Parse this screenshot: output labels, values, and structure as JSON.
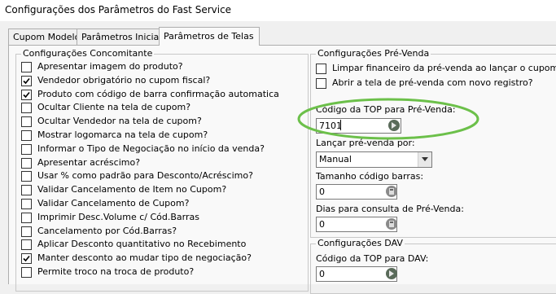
{
  "window": {
    "title": "Configurações dos Parâmetros do Fast Service"
  },
  "tabs": [
    {
      "label": "Cupom Modelo"
    },
    {
      "label": "Parâmetros Iniciais"
    },
    {
      "label": "Parâmetros de Telas"
    }
  ],
  "active_tab": "Parâmetros de Telas",
  "concomitante": {
    "legend": "Configurações Concomitante",
    "items": [
      {
        "label": "Apresentar imagem do produto?",
        "checked": false
      },
      {
        "label": "Vendedor obrigatório no cupom fiscal?",
        "checked": true
      },
      {
        "label": "Produto com código de barra confirmação automatica",
        "checked": true
      },
      {
        "label": "Ocultar Cliente na tela de cupom?",
        "checked": false
      },
      {
        "label": "Ocultar Vendedor na tela de cupom?",
        "checked": false
      },
      {
        "label": "Mostrar logomarca na tela de cupom?",
        "checked": false
      },
      {
        "label": "Informar o Tipo de Negociação no início da venda?",
        "checked": false
      },
      {
        "label": "Apresentar acréscimo?",
        "checked": false
      },
      {
        "label": "Usar % como padrão para Desconto/Acréscimo?",
        "checked": false
      },
      {
        "label": "Validar Cancelamento de Item no Cupom?",
        "checked": false
      },
      {
        "label": "Validar Cancelamento de Cupom?",
        "checked": false
      },
      {
        "label": "Imprimir Desc.Volume c/ Cód.Barras",
        "checked": false
      },
      {
        "label": "Cancelamento por Cód.Barras?",
        "checked": false
      },
      {
        "label": "Aplicar Desconto quantitativo no Recebimento",
        "checked": false
      },
      {
        "label": "Manter desconto ao mudar tipo de negociação?",
        "checked": true
      },
      {
        "label": "Permite troco na troca de produto?",
        "checked": false
      }
    ]
  },
  "prevenda": {
    "legend": "Configurações Pré-Venda",
    "checks": [
      {
        "label": "Limpar financeiro da pré-venda ao lançar o cupom?",
        "checked": false
      },
      {
        "label": "Abrir a tela de pré-venda com novo registro?",
        "checked": false
      }
    ],
    "top_label": "Código da TOP para Pré-Venda:",
    "top_value": "7101",
    "lancar_label": "Lançar pré-venda por:",
    "lancar_value": "Manual",
    "barras_label": "Tamanho código barras:",
    "barras_value": "0",
    "dias_label": "Dias para consulta de Pré-Venda:",
    "dias_value": "0"
  },
  "dav": {
    "legend": "Configurações DAV",
    "top_label": "Código da TOP para DAV:",
    "top_value": "0"
  },
  "colors": {
    "annotation": "#6cc04a",
    "window_bg": "#f0f0f0",
    "panel_bg": "#f9f9f9"
  }
}
